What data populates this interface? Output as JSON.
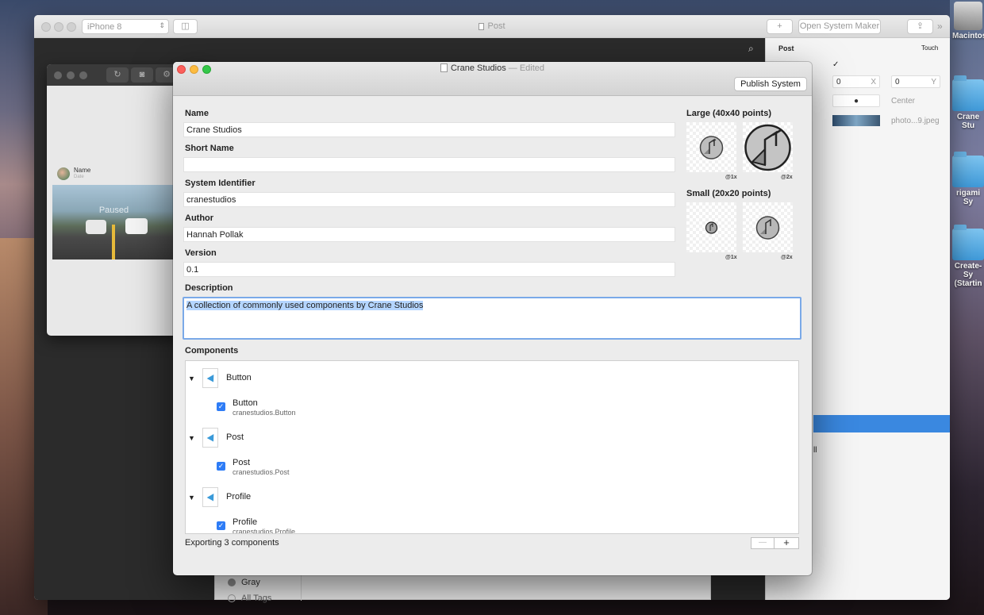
{
  "desktop": {
    "icons": [
      {
        "label": "Macintos"
      },
      {
        "label": "Crane Stu"
      },
      {
        "label": "rigami Sy"
      },
      {
        "label": "Create-Sy"
      },
      {
        "label": "(Startin"
      }
    ]
  },
  "back_window": {
    "device": "iPhone 8",
    "title": "Post",
    "open_system_maker": "Open System Maker",
    "add_button": "+",
    "inspector": {
      "layer_name": "Post",
      "touch_label": "Touch",
      "check": "✓",
      "x_value": "0",
      "x_label": "X",
      "y_value": "0",
      "y_label": "Y",
      "anchor_label": "Center",
      "image_name": "photo...9.jpeg",
      "trailing_text": "ll"
    },
    "tags": {
      "gray": "Gray",
      "all_tags": "All Tags"
    }
  },
  "preview": {
    "name": "Name",
    "date": "Date",
    "paused": "Paused"
  },
  "dialog": {
    "title": "Crane Studios",
    "edited": "— Edited",
    "publish_button": "Publish System",
    "fields": {
      "name_label": "Name",
      "name_value": "Crane Studios",
      "short_name_label": "Short Name",
      "short_name_value": "",
      "system_id_label": "System Identifier",
      "system_id_value": "cranestudios",
      "author_label": "Author",
      "author_value": "Hannah Pollak",
      "version_label": "Version",
      "version_value": "0.1",
      "description_label": "Description",
      "description_value": "A collection of commonly used components by Crane Studios"
    },
    "icons": {
      "large_label": "Large (40x40 points)",
      "small_label": "Small (20x20 points)",
      "scale_1x": "@1x",
      "scale_2x": "@2x"
    },
    "components_label": "Components",
    "components": [
      {
        "group": "Button",
        "item": "Button",
        "id": "cranestudios.Button"
      },
      {
        "group": "Post",
        "item": "Post",
        "id": "cranestudios.Post"
      },
      {
        "group": "Profile",
        "item": "Profile",
        "id": "cranestudios.Profile"
      }
    ],
    "footer": "Exporting 3 components",
    "minus": "—",
    "plus": "+"
  },
  "colors": {
    "accent": "#2e7cf6",
    "close": "#fc605c",
    "minimize": "#fdbc40",
    "zoom": "#34c84a"
  }
}
